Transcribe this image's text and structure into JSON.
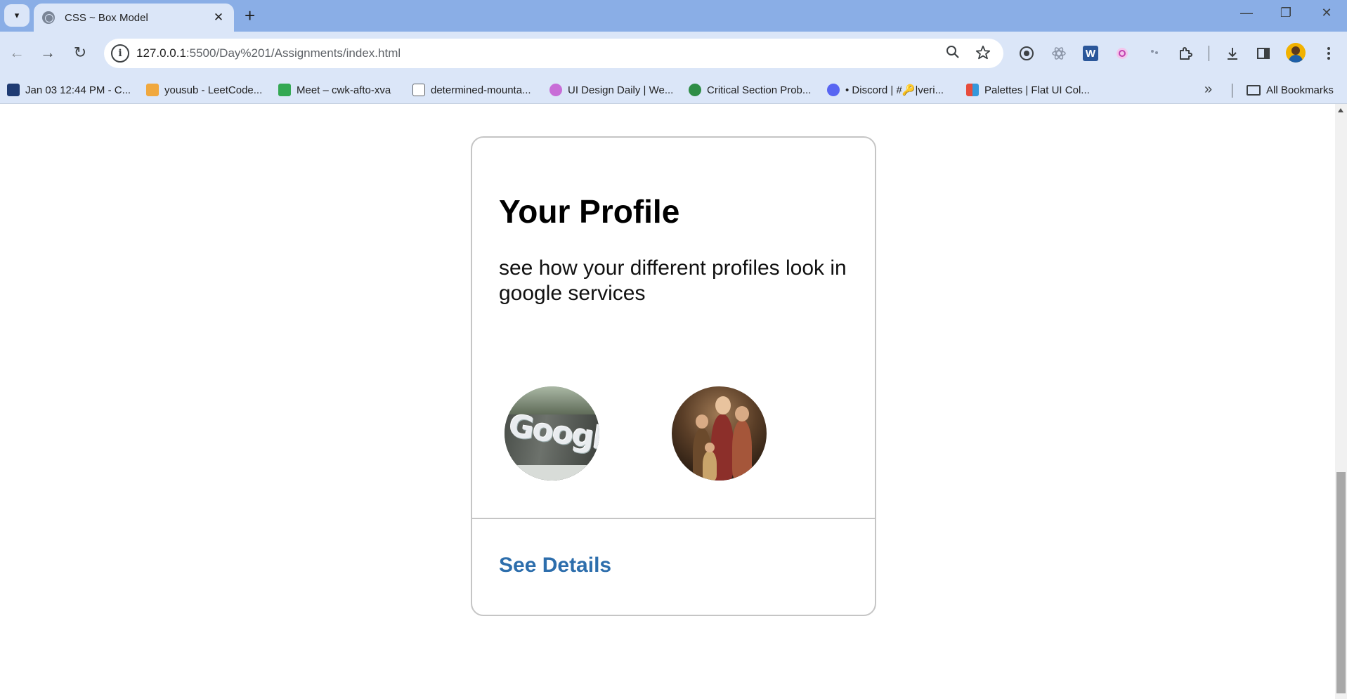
{
  "browser": {
    "tab_title": "CSS ~ Box Model",
    "url_host": "127.0.0.1",
    "url_rest": ":5500/Day%201/Assignments/index.html",
    "new_tab_symbol": "+",
    "close_symbol": "✕",
    "window_controls": {
      "minimize": "—",
      "restore": "❐",
      "close": "✕"
    },
    "nav": {
      "back": "←",
      "forward": "→",
      "reload": "↻"
    },
    "omnibox_icons": [
      "zoom-icon",
      "bookmark-star-icon"
    ],
    "extensions": [
      "extension-1-icon",
      "extension-react-icon",
      "word-icon",
      "extension-pink-icon",
      "extension-dots-icon",
      "extensions-puzzle-icon"
    ],
    "toolbar_icons": [
      "download-icon",
      "side-panel-icon",
      "profile-avatar"
    ]
  },
  "bookmarks": {
    "items": [
      {
        "label": "Jan 03 12:44 PM - C...",
        "color": "#1f3b73"
      },
      {
        "label": "yousub - LeetCode...",
        "color": "#f0a83e"
      },
      {
        "label": "Meet – cwk-afto-xva",
        "color": "#34a853"
      },
      {
        "label": "determined-mounta...",
        "color": "#ffffff"
      },
      {
        "label": "UI Design Daily | We...",
        "color": "#c86dd7"
      },
      {
        "label": "Critical Section Prob...",
        "color": "#2f8d46"
      },
      {
        "label": "• Discord | #🔑|veri...",
        "color": "#5865f2"
      },
      {
        "label": "Palettes | Flat UI Col...",
        "color": "#e74c3c"
      }
    ],
    "more_symbol": "»",
    "all_bookmarks": "All Bookmarks"
  },
  "card": {
    "title": "Your Profile",
    "description": "see how your different profiles look in google services",
    "photos": [
      "google-building-photo",
      "family-photo"
    ],
    "link_label": "See Details",
    "link_color": "#2d6eac"
  }
}
